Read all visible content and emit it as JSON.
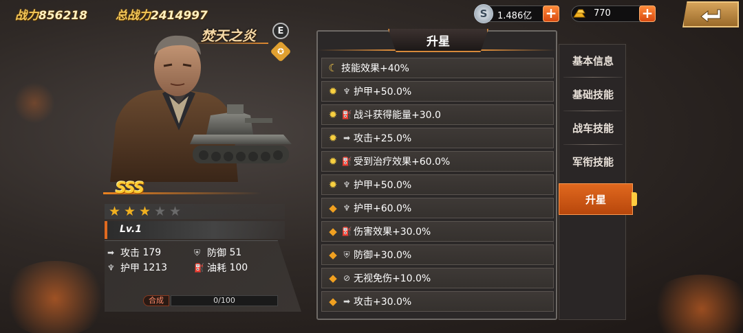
{
  "top_bar": {
    "power_label": "战力",
    "power_value": "856218",
    "total_power_label": "总战力",
    "total_power_value": "2414997",
    "silver_icon": "S",
    "silver_value": "1.486亿",
    "gold_value": "770",
    "plus_label": "+"
  },
  "hero": {
    "name": "焚天之炎",
    "badge_letter": "E",
    "rank": "SSS",
    "stars_filled": 3,
    "stars_total": 5,
    "level": "Lv.1"
  },
  "stats": {
    "attack_label": "攻击",
    "attack_value": "179",
    "defense_label": "防御",
    "defense_value": "51",
    "armor_label": "护甲",
    "armor_value": "1213",
    "fuel_label": "油耗",
    "fuel_value": "100"
  },
  "synthesis": {
    "label": "合成",
    "progress_text": "0/100",
    "progress": 0
  },
  "panel": {
    "title": "升星",
    "rows": [
      {
        "lead": "moon",
        "sub": "",
        "text": "技能效果+40%"
      },
      {
        "lead": "sun",
        "sub": "armor",
        "text": "护甲+50.0%"
      },
      {
        "lead": "sun",
        "sub": "fuel",
        "text": "战斗获得能量+30.0"
      },
      {
        "lead": "sun",
        "sub": "attack",
        "text": "攻击+25.0%"
      },
      {
        "lead": "sun",
        "sub": "fuel",
        "text": "受到治疗效果+60.0%"
      },
      {
        "lead": "sun",
        "sub": "armor",
        "text": "护甲+50.0%"
      },
      {
        "lead": "gem",
        "sub": "armor",
        "text": "护甲+60.0%"
      },
      {
        "lead": "gem",
        "sub": "fuel",
        "text": "伤害效果+30.0%"
      },
      {
        "lead": "gem",
        "sub": "defense",
        "text": "防御+30.0%"
      },
      {
        "lead": "gem",
        "sub": "ignore",
        "text": "无视免伤+10.0%"
      },
      {
        "lead": "gem",
        "sub": "attack",
        "text": "攻击+30.0%"
      }
    ]
  },
  "tabs": [
    "基本信息",
    "基础技能",
    "战车技能",
    "军衔技能",
    "升星"
  ],
  "active_tab": 4,
  "colors": {
    "accent": "#e0681e",
    "gold": "#f3c85a",
    "star_on": "#f0b020",
    "star_off": "#6a6a6a"
  }
}
